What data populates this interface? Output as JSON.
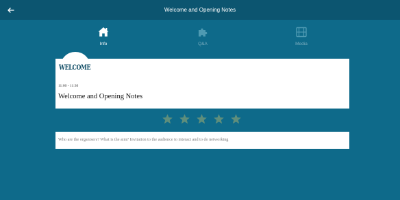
{
  "header": {
    "title": "Welcome and Opening Notes",
    "back_icon": "arrow-left-icon"
  },
  "tabs": [
    {
      "label": "Info",
      "icon": "home-icon",
      "active": true
    },
    {
      "label": "Q&A",
      "icon": "puzzle-icon",
      "active": false
    },
    {
      "label": "Media",
      "icon": "film-icon",
      "active": false
    }
  ],
  "session": {
    "logo_text": "WELCOME",
    "time": "11:00 - 11:30",
    "title": "Welcome and Opening Notes",
    "description": "Who are the organisers? What is the aim? Invitation to the audience to interact and to do networking"
  },
  "rating": {
    "max_stars": 5,
    "selected": 0
  },
  "colors": {
    "background": "#0e6a8a",
    "topbar": "#0c5570",
    "star": "#5e8e7c",
    "icon_inactive": "#4e9ab2"
  }
}
